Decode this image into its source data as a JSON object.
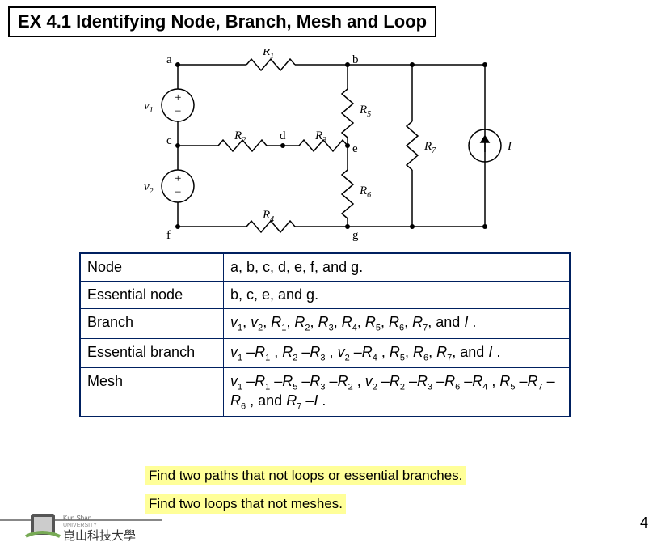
{
  "title": "EX 4.1  Identifying Node, Branch, Mesh and Loop",
  "circuit": {
    "nodes": {
      "a": "a",
      "b": "b",
      "c": "c",
      "d": "d",
      "e": "e",
      "f": "f",
      "g": "g"
    },
    "R1": "R",
    "R1s": "1",
    "R2": "R",
    "R2s": "2",
    "R3": "R",
    "R3s": "3",
    "R4": "R",
    "R4s": "4",
    "R5": "R",
    "R5s": "5",
    "R6": "R",
    "R6s": "6",
    "R7": "R",
    "R7s": "7",
    "v1": "v",
    "v1s": "1",
    "v2": "v",
    "v2s": "2",
    "I": "I",
    "plus": "+",
    "minus": "−"
  },
  "table": {
    "row1_label": "Node",
    "row1_val": "a, b, c, d, e, f, and g.",
    "row2_label": "Essential node",
    "row2_val": "b, c, e, and g.",
    "row3_label": "Branch",
    "row4_label": "Essential branch",
    "row5_label": "Mesh",
    "v": "v",
    "R": "R",
    "I": "I",
    "s1": "1",
    "s2": "2",
    "s3": "3",
    "s4": "4",
    "s5": "5",
    "s6": "6",
    "s7": "7",
    "and": "and",
    "comma": ", ",
    "dash": " –",
    "dot": " ."
  },
  "q1": "Find two paths that  not loops or essential branches.",
  "q2": "Find two loops that  not meshes.",
  "pagenum": "4"
}
